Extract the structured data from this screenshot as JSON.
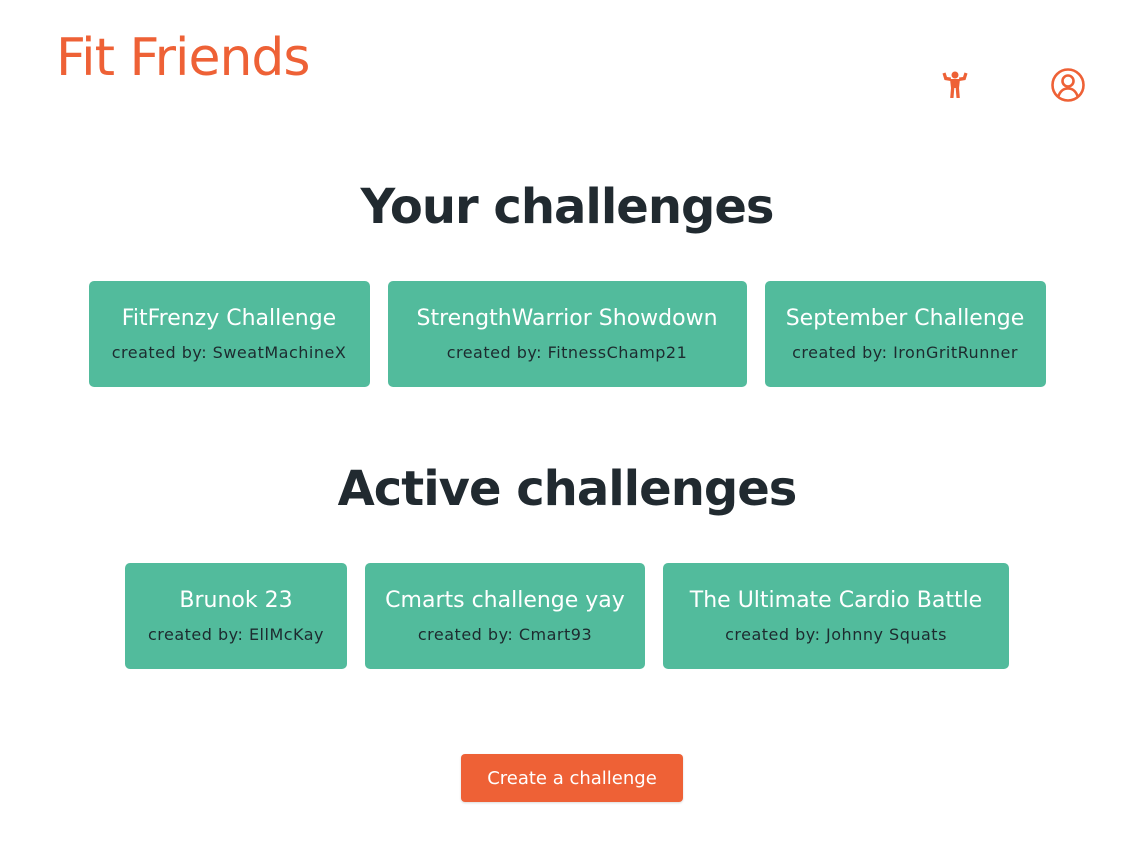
{
  "app": {
    "title": "Fit Friends"
  },
  "header": {
    "icons": [
      {
        "name": "flexing-person-icon",
        "color": "#ee6136"
      },
      {
        "name": "user-circle-icon",
        "color": "#ee6136"
      }
    ]
  },
  "sections": {
    "yours": {
      "heading": "Your challenges",
      "cards": [
        {
          "title": "FitFrenzy Challenge",
          "creator": "created by: SweatMachineX"
        },
        {
          "title": "StrengthWarrior Showdown",
          "creator": "created by: FitnessChamp21"
        },
        {
          "title": "September Challenge",
          "creator": "created by: IronGritRunner"
        }
      ]
    },
    "active": {
      "heading": "Active challenges",
      "cards": [
        {
          "title": "Brunok 23",
          "creator": "created by: EllMcKay"
        },
        {
          "title": "Cmarts challenge yay",
          "creator": "created by: Cmart93"
        },
        {
          "title": "The Ultimate Cardio Battle",
          "creator": "created by: Johnny Squats"
        }
      ]
    }
  },
  "actions": {
    "create_label": "Create a challenge"
  },
  "colors": {
    "brand": "#ee6136",
    "card": "#52bb9c",
    "heading": "#212a30"
  }
}
